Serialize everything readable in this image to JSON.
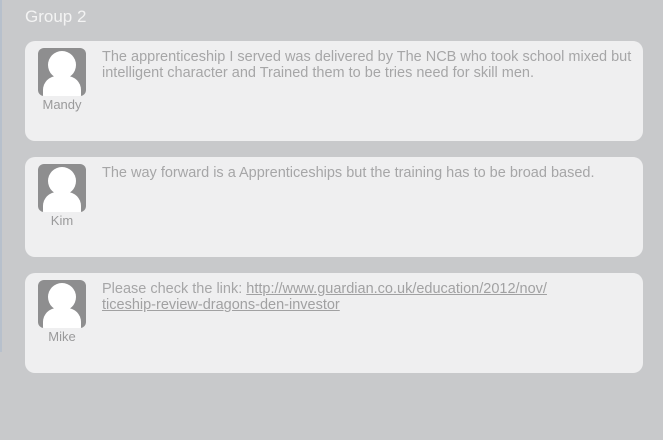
{
  "group": {
    "title": "Group 2"
  },
  "posts": [
    {
      "author": "Mandy",
      "avatar_icon": "user-avatar-icon",
      "text": "The apprenticeship I served was delivered by The NCB who took school mixed but intelligent character and Trained them to be tries need for skill men."
    },
    {
      "author": "Kim",
      "avatar_icon": "user-avatar-icon",
      "text": "The way forward is a Apprenticeships but the training has to be broad based."
    },
    {
      "author": "Mike",
      "avatar_icon": "user-avatar-icon",
      "text_prefix": "Please check the link: ",
      "link_line_1": "http://www.guardian.co.uk/education/2012/nov/",
      "link_line_2": "ticeship-review-dragons-den-investor"
    }
  ],
  "colors": {
    "background": "#c8c9cb",
    "card": "#efeff0",
    "text": "#a6a6a7",
    "avatar": "#8e8e8f"
  }
}
